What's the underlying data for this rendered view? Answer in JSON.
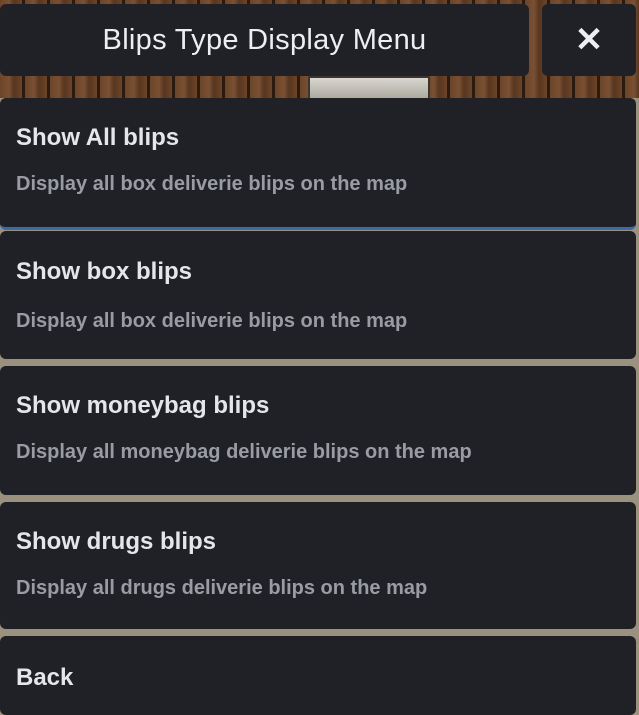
{
  "menu": {
    "title": "Blips Type Display Menu",
    "close_icon": "close-icon",
    "items": [
      {
        "label": "Show All blips",
        "description": "Display all box deliverie blips on the map",
        "selected": true
      },
      {
        "label": "Show box blips",
        "description": "Display all box deliverie blips on the map",
        "selected": false
      },
      {
        "label": "Show moneybag blips",
        "description": "Display all moneybag deliverie blips on the map",
        "selected": false
      },
      {
        "label": "Show drugs blips",
        "description": "Display all drugs deliverie blips on the map",
        "selected": false
      },
      {
        "label": "Back",
        "description": "",
        "selected": false
      }
    ]
  },
  "colors": {
    "panel": "#202126",
    "title_text": "#eceef2",
    "description_text": "#9a9ca3",
    "selection_accent": "#3b6aa8"
  }
}
